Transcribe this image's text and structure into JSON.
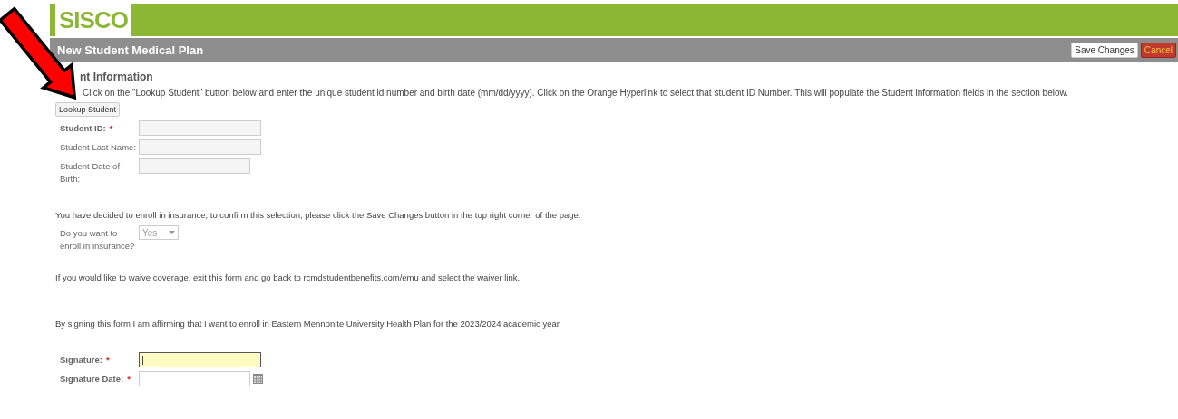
{
  "header": {
    "logo": "SISCO"
  },
  "title_bar": {
    "title": "New Student Medical Plan",
    "buttons": [
      {
        "label": "Save Changes",
        "kind": "save"
      },
      {
        "label": "Cancel",
        "kind": "cancel"
      }
    ]
  },
  "section": {
    "heading": "nt Information",
    "instruction": "Click on the \"Lookup Student\" button below and enter the unique student id number and birth date (mm/dd/yyyy). Click on the Orange Hyperlink to select that student ID Number. This will populate the Student information fields in the section below.",
    "lookup_button": "Lookup Student",
    "fields": [
      {
        "label": "Student ID:",
        "required_mark": "*",
        "kind": "text"
      },
      {
        "label": "Student Last Name:",
        "kind": "text"
      },
      {
        "label": "Student Date of Birth:",
        "kind": "short"
      }
    ]
  },
  "enroll_note": "You have decided to enroll in insurance, to confirm this selection, please click the Save Changes button in the top right corner of the page.",
  "enroll_question": {
    "label": "Do you want to enroll in insurance?",
    "value": "Yes",
    "disabled": true
  },
  "waive_note": "If you would like to waive coverage, exit this form and go back to rcmdstudentbenefits.com/emu and select the waiver link.",
  "affirm_note": "By signing this form I am affirming that I want to enroll in Eastern Mennonite University Health Plan for the 2023/2024 academic year.",
  "signature_fields": [
    {
      "label": "Signature:",
      "required_mark": "*",
      "kind": "text",
      "focused": true
    },
    {
      "label": "Signature Date:",
      "required_mark": "*",
      "kind": "date",
      "focused": false
    }
  ]
}
